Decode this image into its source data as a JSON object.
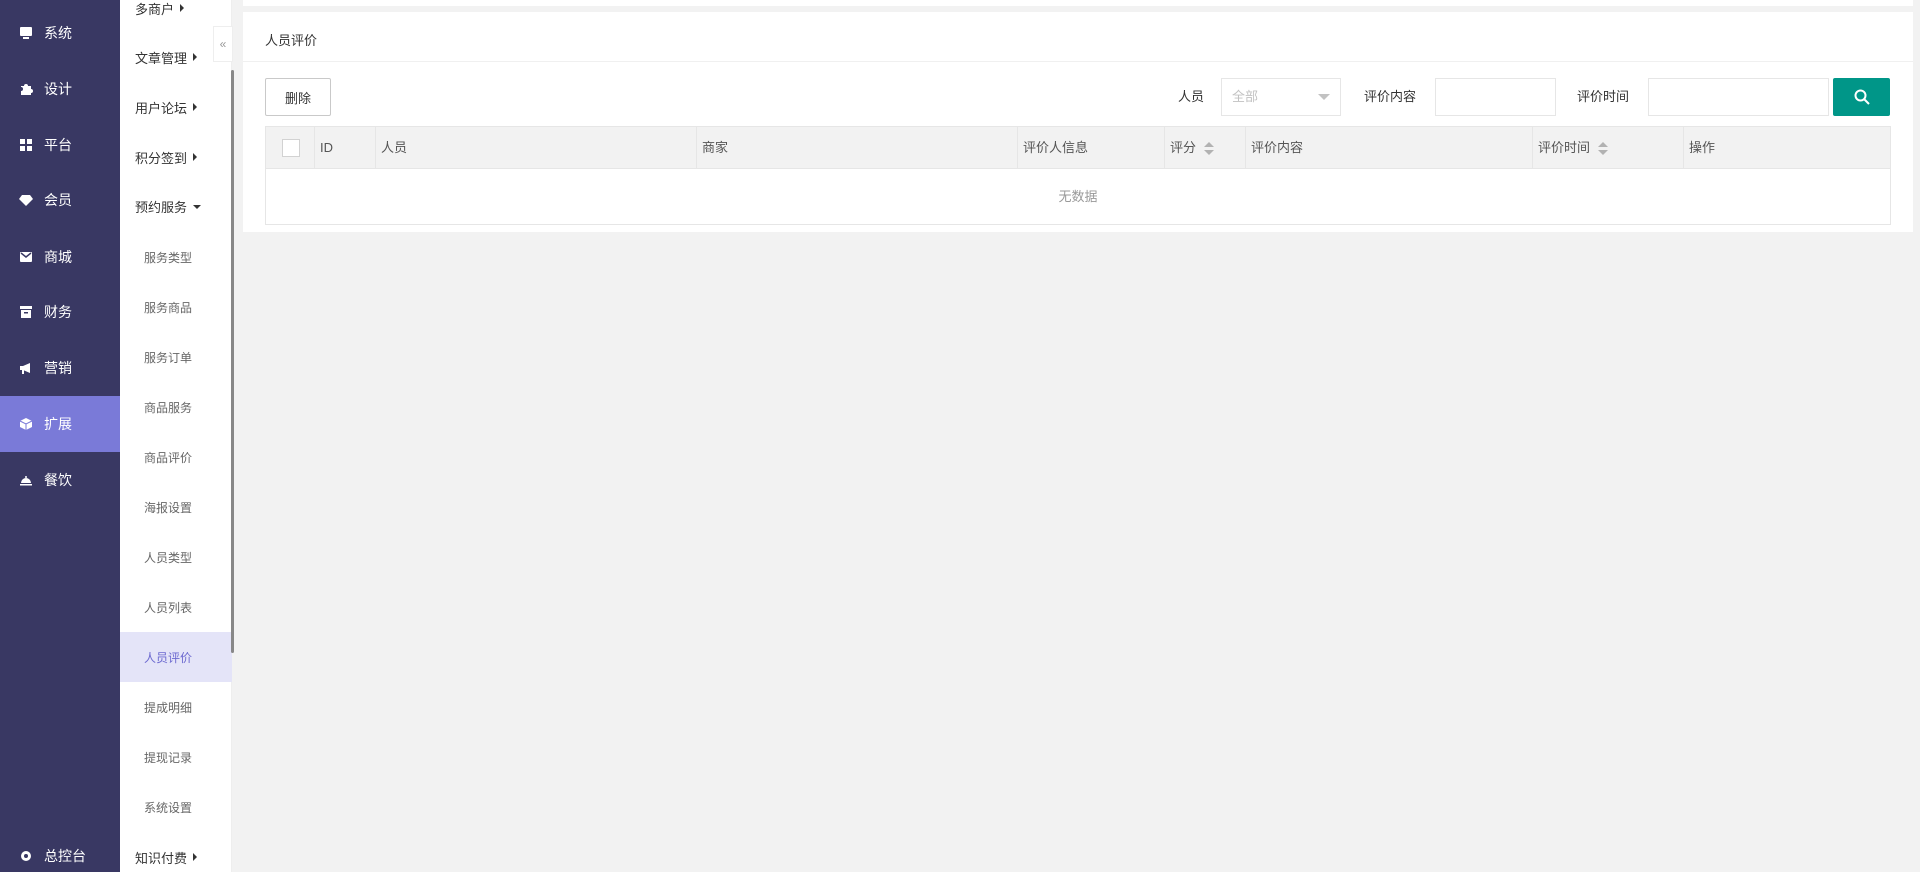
{
  "nav_main": {
    "items": [
      {
        "label": "系统",
        "icon": "monitor-icon"
      },
      {
        "label": "设计",
        "icon": "puzzle-icon"
      },
      {
        "label": "平台",
        "icon": "grid-icon"
      },
      {
        "label": "会员",
        "icon": "diamond-icon"
      },
      {
        "label": "商城",
        "icon": "mail-icon"
      },
      {
        "label": "财务",
        "icon": "archive-icon"
      },
      {
        "label": "营销",
        "icon": "megaphone-icon"
      },
      {
        "label": "扩展",
        "icon": "cube-icon"
      },
      {
        "label": "餐饮",
        "icon": "cloche-icon"
      }
    ],
    "active": "扩展",
    "bottom": {
      "label": "总控台",
      "icon": "gear-icon"
    }
  },
  "nav_sub": {
    "groups": [
      "多商户",
      "文章管理",
      "用户论坛",
      "积分签到",
      "预约服务",
      "知识付费"
    ],
    "items": [
      "服务类型",
      "服务商品",
      "服务订单",
      "商品服务",
      "商品评价",
      "海报设置",
      "人员类型",
      "人员列表",
      "人员评价",
      "提成明细",
      "提现记录",
      "系统设置"
    ],
    "active": "人员评价"
  },
  "page": {
    "title": "人员评价",
    "delete_label": "删除",
    "filters": {
      "staff_label": "人员",
      "staff_value": "全部",
      "content_label": "评价内容",
      "time_label": "评价时间"
    },
    "table": {
      "columns": [
        "ID",
        "人员",
        "商家",
        "评价人信息",
        "评分",
        "评价内容",
        "评价时间",
        "操作"
      ],
      "empty_text": "无数据"
    }
  },
  "colors": {
    "nav_bg": "#393863",
    "nav_active": "#7a7ad8",
    "sub_active_bg": "#e4e4f8",
    "search_btn": "#009688"
  }
}
